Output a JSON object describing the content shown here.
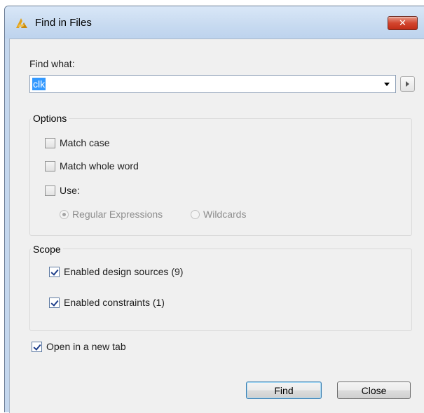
{
  "window": {
    "title": "Find in Files",
    "close_label": "✕"
  },
  "find": {
    "label": "Find what:",
    "value": "clk"
  },
  "options": {
    "title": "Options",
    "match_case": {
      "label": "Match case",
      "checked": false
    },
    "match_whole_word": {
      "label": "Match whole word",
      "checked": false
    },
    "use": {
      "label": "Use:",
      "checked": false
    },
    "radios": [
      {
        "label": "Regular Expressions",
        "selected": true
      },
      {
        "label": "Wildcards",
        "selected": false
      }
    ]
  },
  "scope": {
    "title": "Scope",
    "items": [
      {
        "label": "Enabled design sources (9)",
        "checked": true
      },
      {
        "label": "Enabled constraints (1)",
        "checked": true
      }
    ]
  },
  "open_new_tab": {
    "label": "Open in a new tab",
    "checked": true
  },
  "buttons": {
    "find": "Find",
    "close": "Close"
  },
  "colors": {
    "selection": "#3399ff",
    "dialog_bg": "#f0f0f0",
    "close_red": "#c22d17"
  }
}
